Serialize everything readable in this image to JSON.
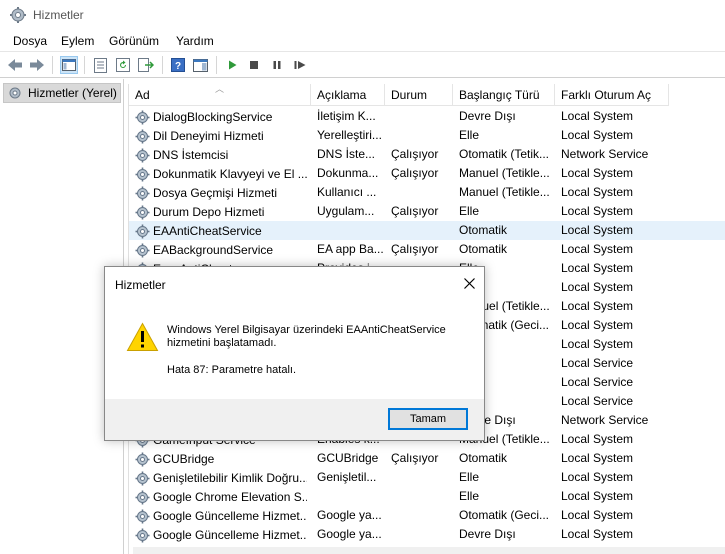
{
  "window": {
    "title": "Hizmetler"
  },
  "menu": [
    "Dosya",
    "Eylem",
    "Görünüm",
    "Yardım"
  ],
  "tree": {
    "root_label": "Hizmetler (Yerel)"
  },
  "columns": [
    "Ad",
    "Açıklama",
    "Durum",
    "Başlangıç Türü",
    "Farklı Oturum Aç"
  ],
  "services": [
    {
      "name": "DialogBlockingService",
      "desc": "İletişim K...",
      "status": "",
      "startup": "Devre Dışı",
      "logon": "Local System"
    },
    {
      "name": "Dil Deneyimi Hizmeti",
      "desc": "Yerelleştiri...",
      "status": "",
      "startup": "Elle",
      "logon": "Local System"
    },
    {
      "name": "DNS İstemcisi",
      "desc": "DNS İste...",
      "status": "Çalışıyor",
      "startup": "Otomatik (Tetik...",
      "logon": "Network Service"
    },
    {
      "name": "Dokunmatik Klavyeyi ve El ...",
      "desc": "Dokunma...",
      "status": "Çalışıyor",
      "startup": "Manuel (Tetikle...",
      "logon": "Local System"
    },
    {
      "name": "Dosya Geçmişi Hizmeti",
      "desc": "Kullanıcı ...",
      "status": "",
      "startup": "Manuel (Tetikle...",
      "logon": "Local System"
    },
    {
      "name": "Durum Depo Hizmeti",
      "desc": "Uygulam...",
      "status": "Çalışıyor",
      "startup": "Elle",
      "logon": "Local System"
    },
    {
      "name": "EAAntiCheatService",
      "desc": "",
      "status": "",
      "startup": "Otomatik",
      "logon": "Local System",
      "selected": true
    },
    {
      "name": "EABackgroundService",
      "desc": "EA app Ba...",
      "status": "Çalışıyor",
      "startup": "Otomatik",
      "logon": "Local System"
    },
    {
      "name": "EasyAntiCheat",
      "desc": "Provides i...",
      "status": "",
      "startup": "Elle",
      "logon": "Local System"
    },
    {
      "name": "",
      "desc": "",
      "status": "",
      "startup": "",
      "logon": "Local System"
    },
    {
      "name": "",
      "desc": "",
      "status": "",
      "startup": "Manuel (Tetikle...",
      "logon": "Local System"
    },
    {
      "name": "",
      "desc": "",
      "status": "",
      "startup": "Otomatik (Geci...",
      "logon": "Local System"
    },
    {
      "name": "",
      "desc": "",
      "status": "",
      "startup": "",
      "logon": "Local System"
    },
    {
      "name": "",
      "desc": "",
      "status": "",
      "startup": "",
      "logon": "Local Service"
    },
    {
      "name": "",
      "desc": "",
      "status": "",
      "startup": "",
      "logon": "Local Service"
    },
    {
      "name": "",
      "desc": "",
      "status": "",
      "startup": "",
      "logon": "Local Service"
    },
    {
      "name": "",
      "desc": "",
      "status": "",
      "startup": "Devre Dışı",
      "logon": "Network Service"
    },
    {
      "name": "GameInput Service",
      "desc": "Enables k...",
      "status": "",
      "startup": "Manuel (Tetikle...",
      "logon": "Local System"
    },
    {
      "name": "GCUBridge",
      "desc": "GCUBridge",
      "status": "Çalışıyor",
      "startup": "Otomatik",
      "logon": "Local System"
    },
    {
      "name": "Genişletilebilir Kimlik Doğru...",
      "desc": "Genişletil...",
      "status": "",
      "startup": "Elle",
      "logon": "Local System"
    },
    {
      "name": "Google Chrome Elevation S...",
      "desc": "",
      "status": "",
      "startup": "Elle",
      "logon": "Local System"
    },
    {
      "name": "Google Güncelleme Hizmet...",
      "desc": "Google ya...",
      "status": "",
      "startup": "Otomatik (Geci...",
      "logon": "Local System"
    },
    {
      "name": "Google Güncelleme Hizmet...",
      "desc": "Google ya...",
      "status": "",
      "startup": "Devre Dışı",
      "logon": "Local System"
    }
  ],
  "dialog": {
    "title": "Hizmetler",
    "message": "Windows Yerel Bilgisayar üzerindeki EAAntiCheatService hizmetini başlatamadı.",
    "error": "Hata 87: Parametre hatalı.",
    "ok_label": "Tamam"
  },
  "colors": {
    "accent": "#0078d7",
    "selected_row": "#e5f1fb"
  }
}
